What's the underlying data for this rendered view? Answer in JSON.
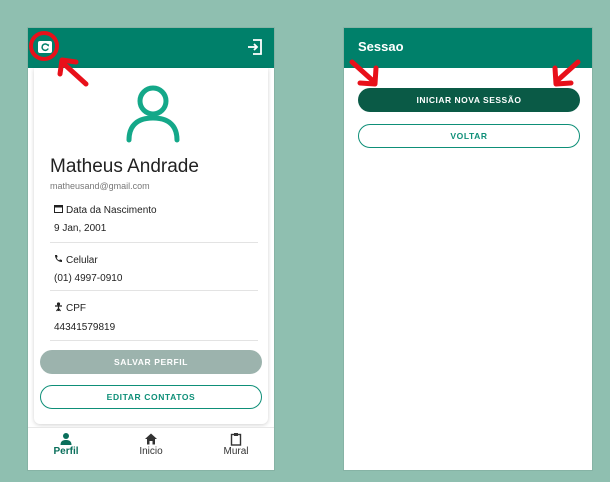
{
  "profile_screen": {
    "user": {
      "name": "Matheus Andrade",
      "email": "matheusand@gmail.com"
    },
    "fields": [
      {
        "icon": "calendar-icon",
        "label": "Data da Nascimento",
        "value": "9 Jan, 2001"
      },
      {
        "icon": "phone-icon",
        "label": "Celular",
        "value": "(01) 4997-0910"
      },
      {
        "icon": "id-icon",
        "label": "CPF",
        "value": "44341579819"
      }
    ],
    "buttons": {
      "save": "SALVAR PERFIL",
      "edit_contacts": "EDITAR CONTATOS"
    },
    "nav": [
      {
        "icon": "person-icon",
        "label": "Perfil",
        "active": true
      },
      {
        "icon": "home-icon",
        "label": "Inicio",
        "active": false
      },
      {
        "icon": "clipboard-icon",
        "label": "Mural",
        "active": false
      }
    ]
  },
  "session_screen": {
    "title": "Sessao",
    "buttons": {
      "start": "INICIAR NOVA SESSÃO",
      "back": "VOLTAR"
    }
  },
  "colors": {
    "appbar": "#00806a",
    "accent": "#0e8f78",
    "primary_dark": "#0a5a46",
    "disabled": "#9cb3ad",
    "annotation": "#e8101a",
    "background": "#8fbfb0"
  }
}
